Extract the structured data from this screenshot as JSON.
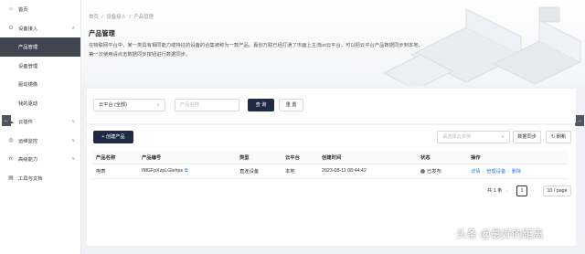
{
  "sidebar": {
    "items": [
      {
        "label": "首页",
        "icon": "home-icon",
        "glyph": "⌂"
      },
      {
        "label": "设备接入",
        "icon": "device-icon",
        "glyph": "⊙",
        "chevron": "∧"
      },
      {
        "label": "产品管理",
        "sub": true,
        "active": true
      },
      {
        "label": "设备管理",
        "sub": true
      },
      {
        "label": "驱动镜像",
        "sub": true
      },
      {
        "label": "我的驱动",
        "sub": true
      },
      {
        "label": "云插件",
        "icon": "cloud-plugin-icon",
        "glyph": "☁",
        "chevron": "∨"
      },
      {
        "label": "运维监控",
        "icon": "monitor-icon",
        "glyph": "◎",
        "chevron": "∨"
      },
      {
        "label": "高级能力",
        "icon": "advanced-icon",
        "glyph": "fx",
        "chevron": "∨"
      },
      {
        "label": "工具与文档",
        "icon": "docs-icon",
        "glyph": "▤"
      }
    ]
  },
  "breadcrumb": [
    "首页",
    "/",
    "设备接入",
    "/",
    "产品管理"
  ],
  "header": {
    "title": "产品管理",
    "desc_line1": "在物联网平台中，某一类具有相同能力或特征的设备的合集被称为一款产品。嘉创万联已经打通了市面上主流iot云平台，可以把云平台产品数据同步到本地，",
    "desc_line2": "第一次使用请点击数据同步按钮进行数据同步。"
  },
  "search": {
    "platform_value": "云平台 (全部)",
    "name_placeholder": "产品名称",
    "query_label": "查 询",
    "reset_label": "重 置"
  },
  "toolbar": {
    "create_label": "+ 创建产品",
    "instance_placeholder": "请选择云实例",
    "sync_label": "数据同步",
    "refresh_label": "刷新"
  },
  "table": {
    "headers": [
      "产品名称",
      "产品编号",
      "类型",
      "云平台",
      "创建时间",
      "状态",
      "操作"
    ],
    "rows": [
      {
        "name": "电表",
        "code": "IMGFpXzpLGlehps",
        "type": "直连设备",
        "platform": "本地",
        "created": "2023-08-11 08:44:42",
        "status": "已发布",
        "op_detail": "详情",
        "op_manage": "管理设备",
        "op_delete": "删除"
      }
    ]
  },
  "pagination": {
    "total": "共 1 条",
    "current": "1",
    "page_size": "10 / page"
  },
  "watermark": "头条 @最好的距离",
  "colors": {
    "primary_dark": "#1f2a44",
    "active_side": "#41454f",
    "link": "#3b7ddd"
  }
}
